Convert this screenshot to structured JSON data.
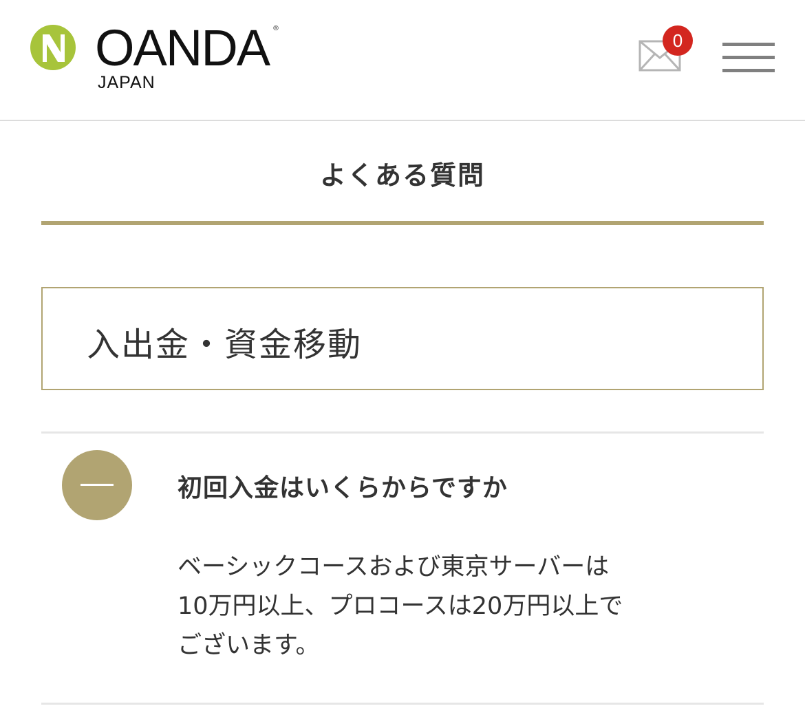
{
  "header": {
    "logo": {
      "wordmark": "OANDA",
      "registered": "®",
      "sub": "JAPAN",
      "mark_color_green": "#a7c43b",
      "mark_color_white": "#ffffff"
    },
    "mail": {
      "icon": "envelope-icon",
      "badge_count": "0",
      "badge_color": "#d3261f"
    },
    "menu": {
      "icon": "hamburger-menu-icon"
    }
  },
  "page": {
    "title": "よくある質問",
    "accent_color": "#b1a472"
  },
  "category": {
    "label": "入出金・資金移動"
  },
  "faq": {
    "items": [
      {
        "toggle_icon": "minus-icon",
        "question": "初回入金はいくらからですか",
        "answer_lines": [
          "ベーシックコースおよび東京サーバーは",
          "10万円以上、プロコースは20万円以上で",
          "ございます。"
        ]
      }
    ]
  }
}
